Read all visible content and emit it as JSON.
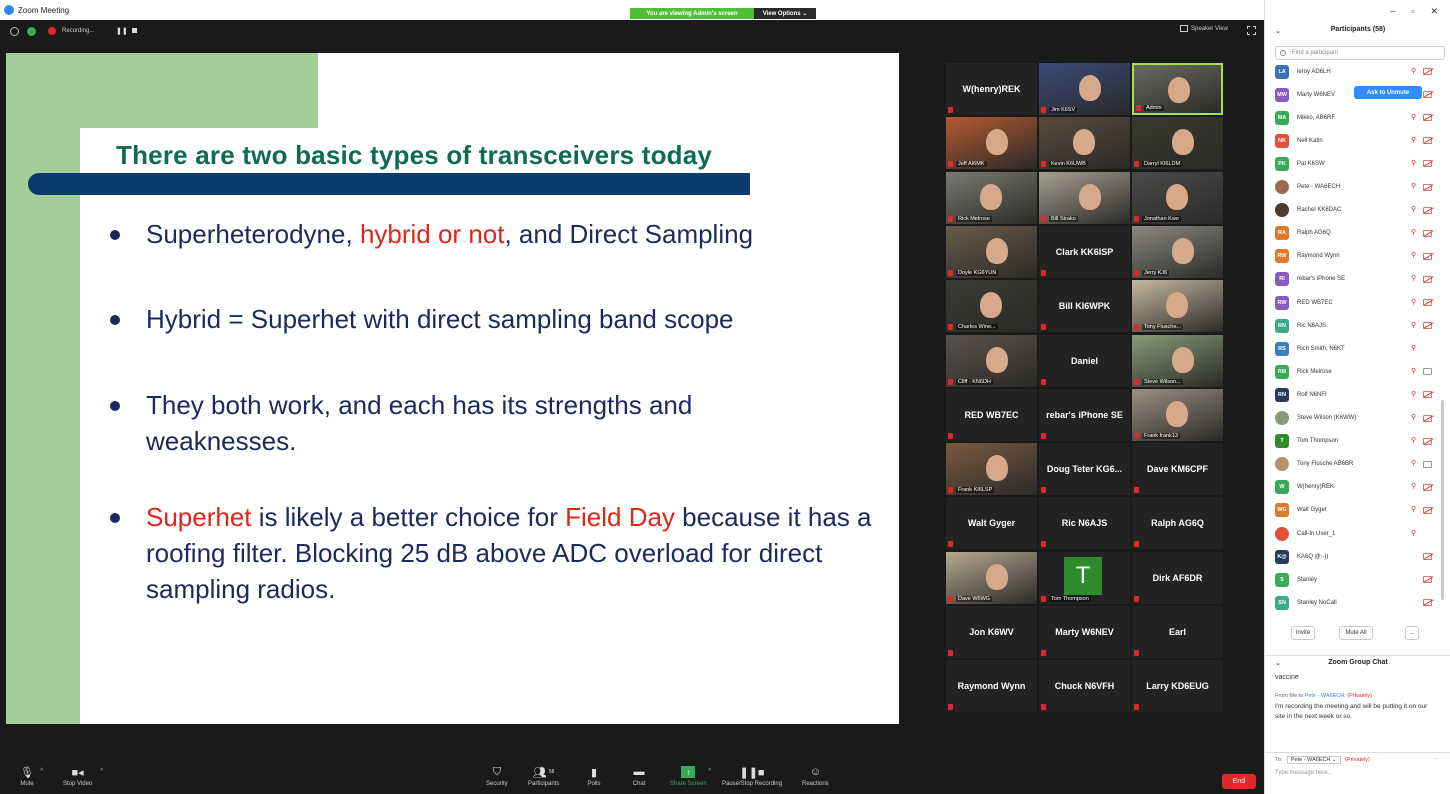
{
  "window": {
    "title": "Zoom Meeting",
    "viewing_banner": "You are viewing Admin's screen",
    "view_options": "View Options ⌄",
    "recording_label": "Recording...",
    "speaker_view": "Speaker View",
    "win_controls": [
      "–",
      "▫",
      "✕"
    ]
  },
  "slide": {
    "title": "There are two basic types of transceivers today",
    "bullets": [
      {
        "parts": [
          {
            "t": "Superheterodyne, ",
            "red": false
          },
          {
            "t": "hybrid or not",
            "red": true
          },
          {
            "t": ",  and Direct Sampling",
            "red": false
          }
        ]
      },
      {
        "parts": [
          {
            "t": "Hybrid = Superhet with direct sampling band scope",
            "red": false
          }
        ]
      },
      {
        "parts": [
          {
            "t": "They both work, and each has its strengths and weaknesses.",
            "red": false
          }
        ]
      },
      {
        "parts": [
          {
            "t": "Superhet",
            "red": true
          },
          {
            "t": " is likely a better choice for ",
            "red": false
          },
          {
            "t": "Field Day",
            "red": true
          },
          {
            "t": " because it has a roofing filter. Blocking 25 dB above ADC overload for direct sampling radios.",
            "red": false
          }
        ]
      }
    ]
  },
  "gallery": [
    {
      "label": "W(henry)REK",
      "kind": "name"
    },
    {
      "label": "Jim K6SV",
      "kind": "photo",
      "bg": "#3a4a7a"
    },
    {
      "label": "Admin",
      "kind": "photo",
      "bg": "#6a6a60",
      "active": true
    },
    {
      "label": "Jeff AI6MK",
      "kind": "photo",
      "bg": "#b45a30"
    },
    {
      "label": "Kevin K6UWB",
      "kind": "photo",
      "bg": "#5a4a3a"
    },
    {
      "label": "Darryl KI6LDM",
      "kind": "photo",
      "bg": "#3a3a2a"
    },
    {
      "label": "Rick Melrose",
      "kind": "photo",
      "bg": "#7a7a70"
    },
    {
      "label": "Bill Strako",
      "kind": "photo",
      "bg": "#a8a090"
    },
    {
      "label": "Jonathan Kwo",
      "kind": "photo",
      "bg": "#4a4a48"
    },
    {
      "label": "Doyle KG6YUN",
      "kind": "photo",
      "bg": "#6a5a48"
    },
    {
      "label": "Clark KK6ISP",
      "kind": "name"
    },
    {
      "label": "Jerry KJ6",
      "kind": "photo",
      "bg": "#8a8880"
    },
    {
      "label": "Charles Wine...",
      "kind": "photo",
      "bg": "#3a3a36"
    },
    {
      "label": "Bill KI6WPK",
      "kind": "name"
    },
    {
      "label": "Tony Flusche...",
      "kind": "photo",
      "bg": "#c8b8a0"
    },
    {
      "label": "Cliff - KN6DH",
      "kind": "photo",
      "bg": "#5a5248"
    },
    {
      "label": "Daniel",
      "kind": "name"
    },
    {
      "label": "Steve Wilson...",
      "kind": "photo",
      "bg": "#8a9a78"
    },
    {
      "label": "RED  WB7EC",
      "kind": "name"
    },
    {
      "label": "rebar's iPhone SE",
      "kind": "name"
    },
    {
      "label": "Frank frank13",
      "kind": "photo",
      "bg": "#9a9080"
    },
    {
      "label": "Frank KI6LSP",
      "kind": "photo",
      "bg": "#7a5a40"
    },
    {
      "label": "Doug  Teter  KG6...",
      "kind": "name"
    },
    {
      "label": "Dave KM6CPF",
      "kind": "name"
    },
    {
      "label": "Walt Gyger",
      "kind": "name"
    },
    {
      "label": "Ric N6AJS",
      "kind": "name"
    },
    {
      "label": "Ralph AG6Q",
      "kind": "name"
    },
    {
      "label": "Dave W6WG",
      "kind": "photo",
      "bg": "#b8a890"
    },
    {
      "label": "Tom Thompson",
      "kind": "avatar",
      "letter": "T"
    },
    {
      "label": "Dirk AF6DR",
      "kind": "name"
    },
    {
      "label": "Jon K6WV",
      "kind": "name"
    },
    {
      "label": "Marty W6NEV",
      "kind": "name"
    },
    {
      "label": "Earl",
      "kind": "name"
    },
    {
      "label": "Raymond Wynn",
      "kind": "name"
    },
    {
      "label": "Chuck N6VFH",
      "kind": "name"
    },
    {
      "label": "Larry KD6EUG",
      "kind": "name"
    }
  ],
  "toolbar": {
    "mute": "Mute",
    "stop_video": "Stop Video",
    "security": "Security",
    "participants": "Participants",
    "participants_count": "58",
    "polls": "Polls",
    "chat": "Chat",
    "share_screen": "Share Screen",
    "pause_recording": "Pause/Stop Recording",
    "reactions": "Reactions",
    "end": "End"
  },
  "participants": {
    "header": "Participants (58)",
    "search_placeholder": "Find a participant",
    "ask_to_unmute": "Ask to Unmute",
    "list": [
      {
        "initials": "LA",
        "name": "leroy AD6LH",
        "color": "#3b6fb6",
        "cam": "off",
        "mic": "off"
      },
      {
        "initials": "MW",
        "name": "Marty W6NEV",
        "color": "#8a5cc2",
        "cam": "off",
        "mic": "none"
      },
      {
        "initials": "MA",
        "name": "Mikko, AB6RF",
        "color": "#3aaa5a",
        "cam": "off",
        "mic": "off"
      },
      {
        "initials": "NK",
        "name": "Neil Katin",
        "color": "#e0503a",
        "cam": "off",
        "mic": "off"
      },
      {
        "initials": "PK",
        "name": "Pat K6SW",
        "color": "#3aaa5a",
        "cam": "off",
        "mic": "off"
      },
      {
        "initials": "",
        "name": "Pete - WA6ECH",
        "color": "#9a6a50",
        "cam": "off",
        "mic": "off"
      },
      {
        "initials": "",
        "name": "Rachel KK6DAC",
        "color": "#4a3a30",
        "cam": "off",
        "mic": "off"
      },
      {
        "initials": "RA",
        "name": "Ralph AG6Q",
        "color": "#e07a2a",
        "cam": "off",
        "mic": "off"
      },
      {
        "initials": "RW",
        "name": "Raymond Wynn",
        "color": "#e07a2a",
        "cam": "off",
        "mic": "off"
      },
      {
        "initials": "RI",
        "name": "rebar's iPhone SE",
        "color": "#8a5cc2",
        "cam": "off",
        "mic": "off"
      },
      {
        "initials": "RW",
        "name": "RED  WB7EC",
        "color": "#8a5cc2",
        "cam": "off",
        "mic": "off"
      },
      {
        "initials": "RN",
        "name": "Ric N6AJS",
        "color": "#3aaa8a",
        "cam": "off",
        "mic": "off"
      },
      {
        "initials": "RS",
        "name": "Rich Smith, N6KT",
        "color": "#3b7fc6",
        "cam": "none",
        "mic": "off"
      },
      {
        "initials": "RM",
        "name": "Rick Melrose",
        "color": "#3aaa5a",
        "cam": "on",
        "mic": "off"
      },
      {
        "initials": "RN",
        "name": "Rolf N6NFI",
        "color": "#2a3a5a",
        "cam": "off",
        "mic": "off"
      },
      {
        "initials": "",
        "name": "Steve Wilson (K6WW)",
        "color": "#8a9a78",
        "cam": "off",
        "mic": "off"
      },
      {
        "initials": "T",
        "name": "Tom Thompson",
        "color": "#2e8b2e",
        "cam": "off",
        "mic": "off"
      },
      {
        "initials": "",
        "name": "Tony Flusche AB6BR",
        "color": "#b89070",
        "cam": "on",
        "mic": "off"
      },
      {
        "initials": "W",
        "name": "W(henry)REK",
        "color": "#3aaa5a",
        "cam": "off",
        "mic": "off"
      },
      {
        "initials": "WG",
        "name": "Walt Gyger",
        "color": "#e07a2a",
        "cam": "off",
        "mic": "off"
      },
      {
        "initials": "",
        "name": "Call-In User_1",
        "color": "#e0503a",
        "cam": "none",
        "mic": "off"
      },
      {
        "initials": "K@",
        "name": "KA6Q @:-))",
        "color": "#2a3a5a",
        "cam": "off",
        "mic": "none"
      },
      {
        "initials": "S",
        "name": "Stanley",
        "color": "#3aaa5a",
        "cam": "off",
        "mic": "none"
      },
      {
        "initials": "SN",
        "name": "Stanley NoCall",
        "color": "#3aaa8a",
        "cam": "off",
        "mic": "none"
      }
    ],
    "invite": "Invite",
    "mute_all": "Mute All",
    "more": "..."
  },
  "chat": {
    "header": "Zoom Group Chat",
    "prev_message": "vaccine",
    "from_prefix": "From Me to ",
    "from_to": "Pete - WA6ECH:",
    "privately": "(Privately)",
    "message": "I'm recording the meeting and will be putting it on our site in the next week or so.",
    "to_label": "To:",
    "to_value": "Pete - WA6ECH ⌄",
    "input_placeholder": "Type message here..."
  }
}
